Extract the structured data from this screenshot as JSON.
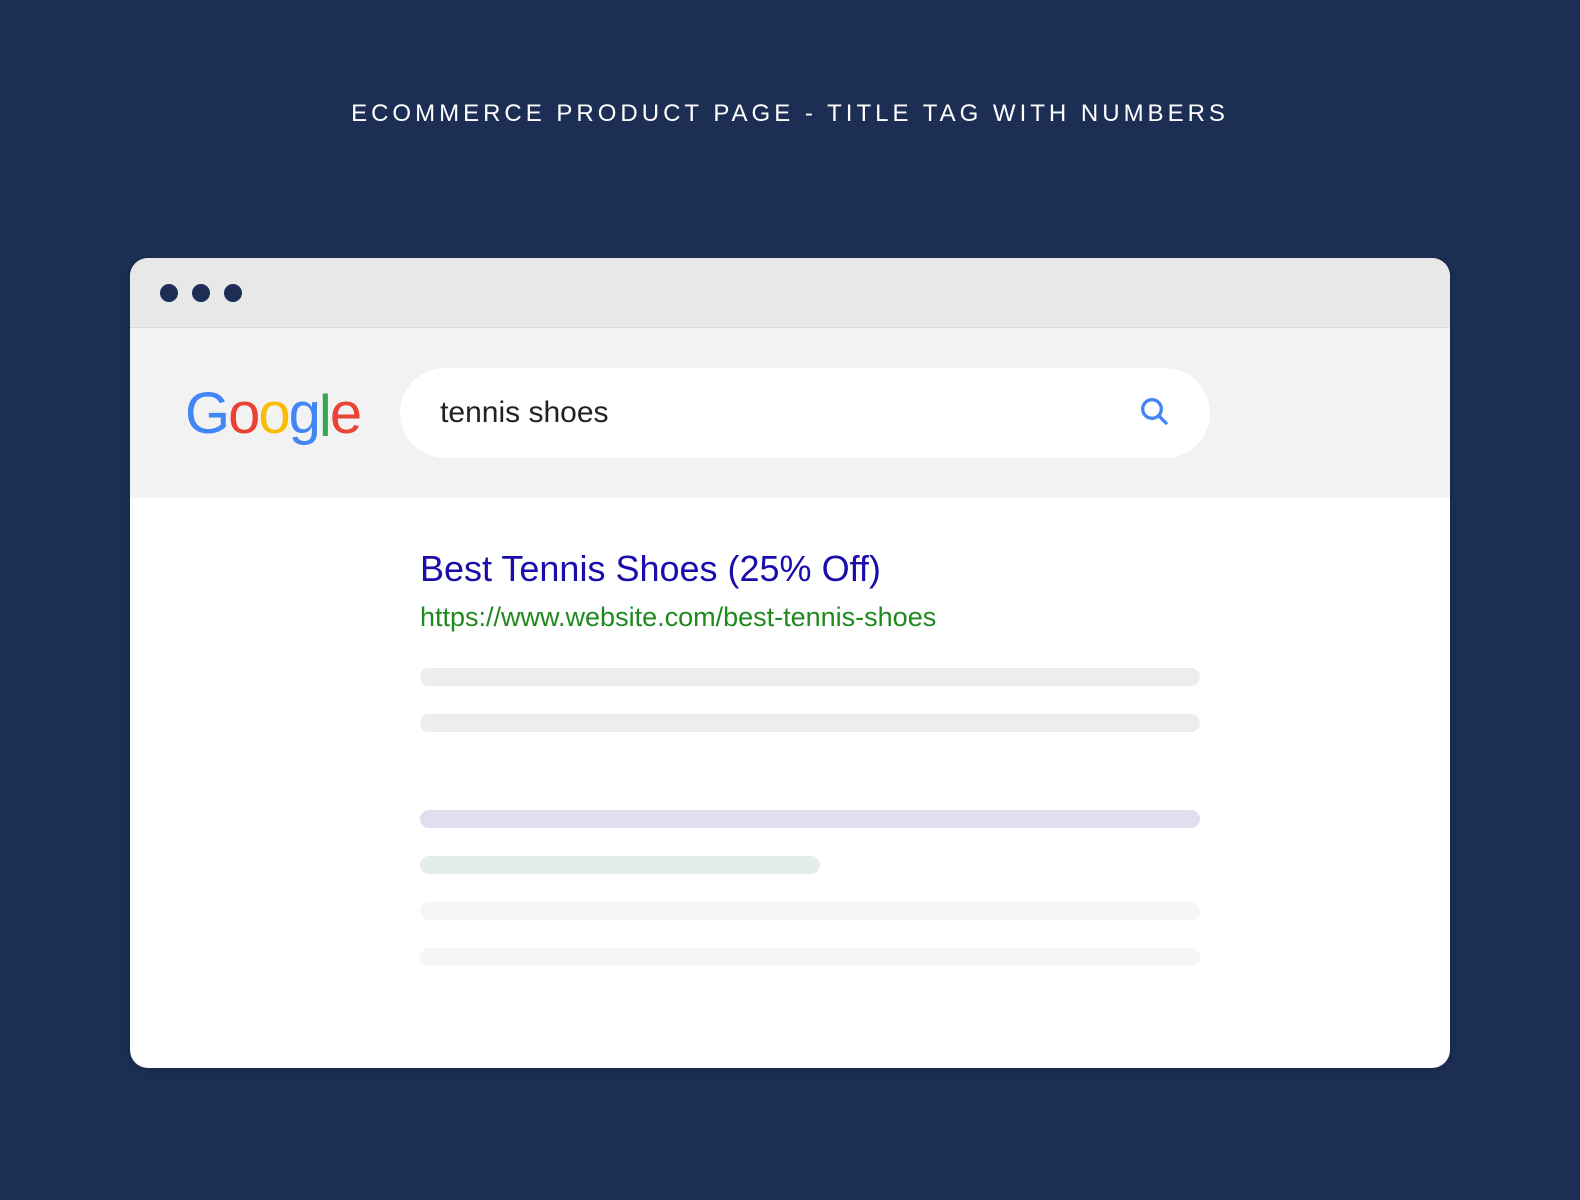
{
  "heading": "ECOMMERCE PRODUCT PAGE - TITLE TAG WITH NUMBERS",
  "logo": {
    "letters": [
      "G",
      "o",
      "o",
      "g",
      "l",
      "e"
    ]
  },
  "search": {
    "query": "tennis shoes"
  },
  "result": {
    "title": "Best Tennis Shoes (25% Off)",
    "url": "https://www.website.com/best-tennis-shoes"
  }
}
